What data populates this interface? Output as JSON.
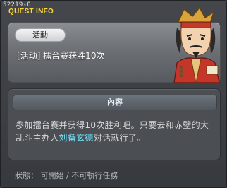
{
  "window": {
    "quest_id": "52219-0",
    "title": "QUEST INFO"
  },
  "quest": {
    "category": "活動",
    "name": "[活动] 擂台赛获胜10次"
  },
  "content": {
    "header": "內容",
    "text_before": "参加擂台赛并获得10次胜利吧。只要去和赤壁的大乱斗主办人",
    "npc": "刘备玄德",
    "text_after": "对话就行了。"
  },
  "status": {
    "text": "狀態： 可開始 / 不可執行任務"
  },
  "colors": {
    "title": "#ffd83a",
    "npc_link": "#6fe4ff"
  },
  "icons": {
    "portrait": "npc-portrait-icon"
  }
}
